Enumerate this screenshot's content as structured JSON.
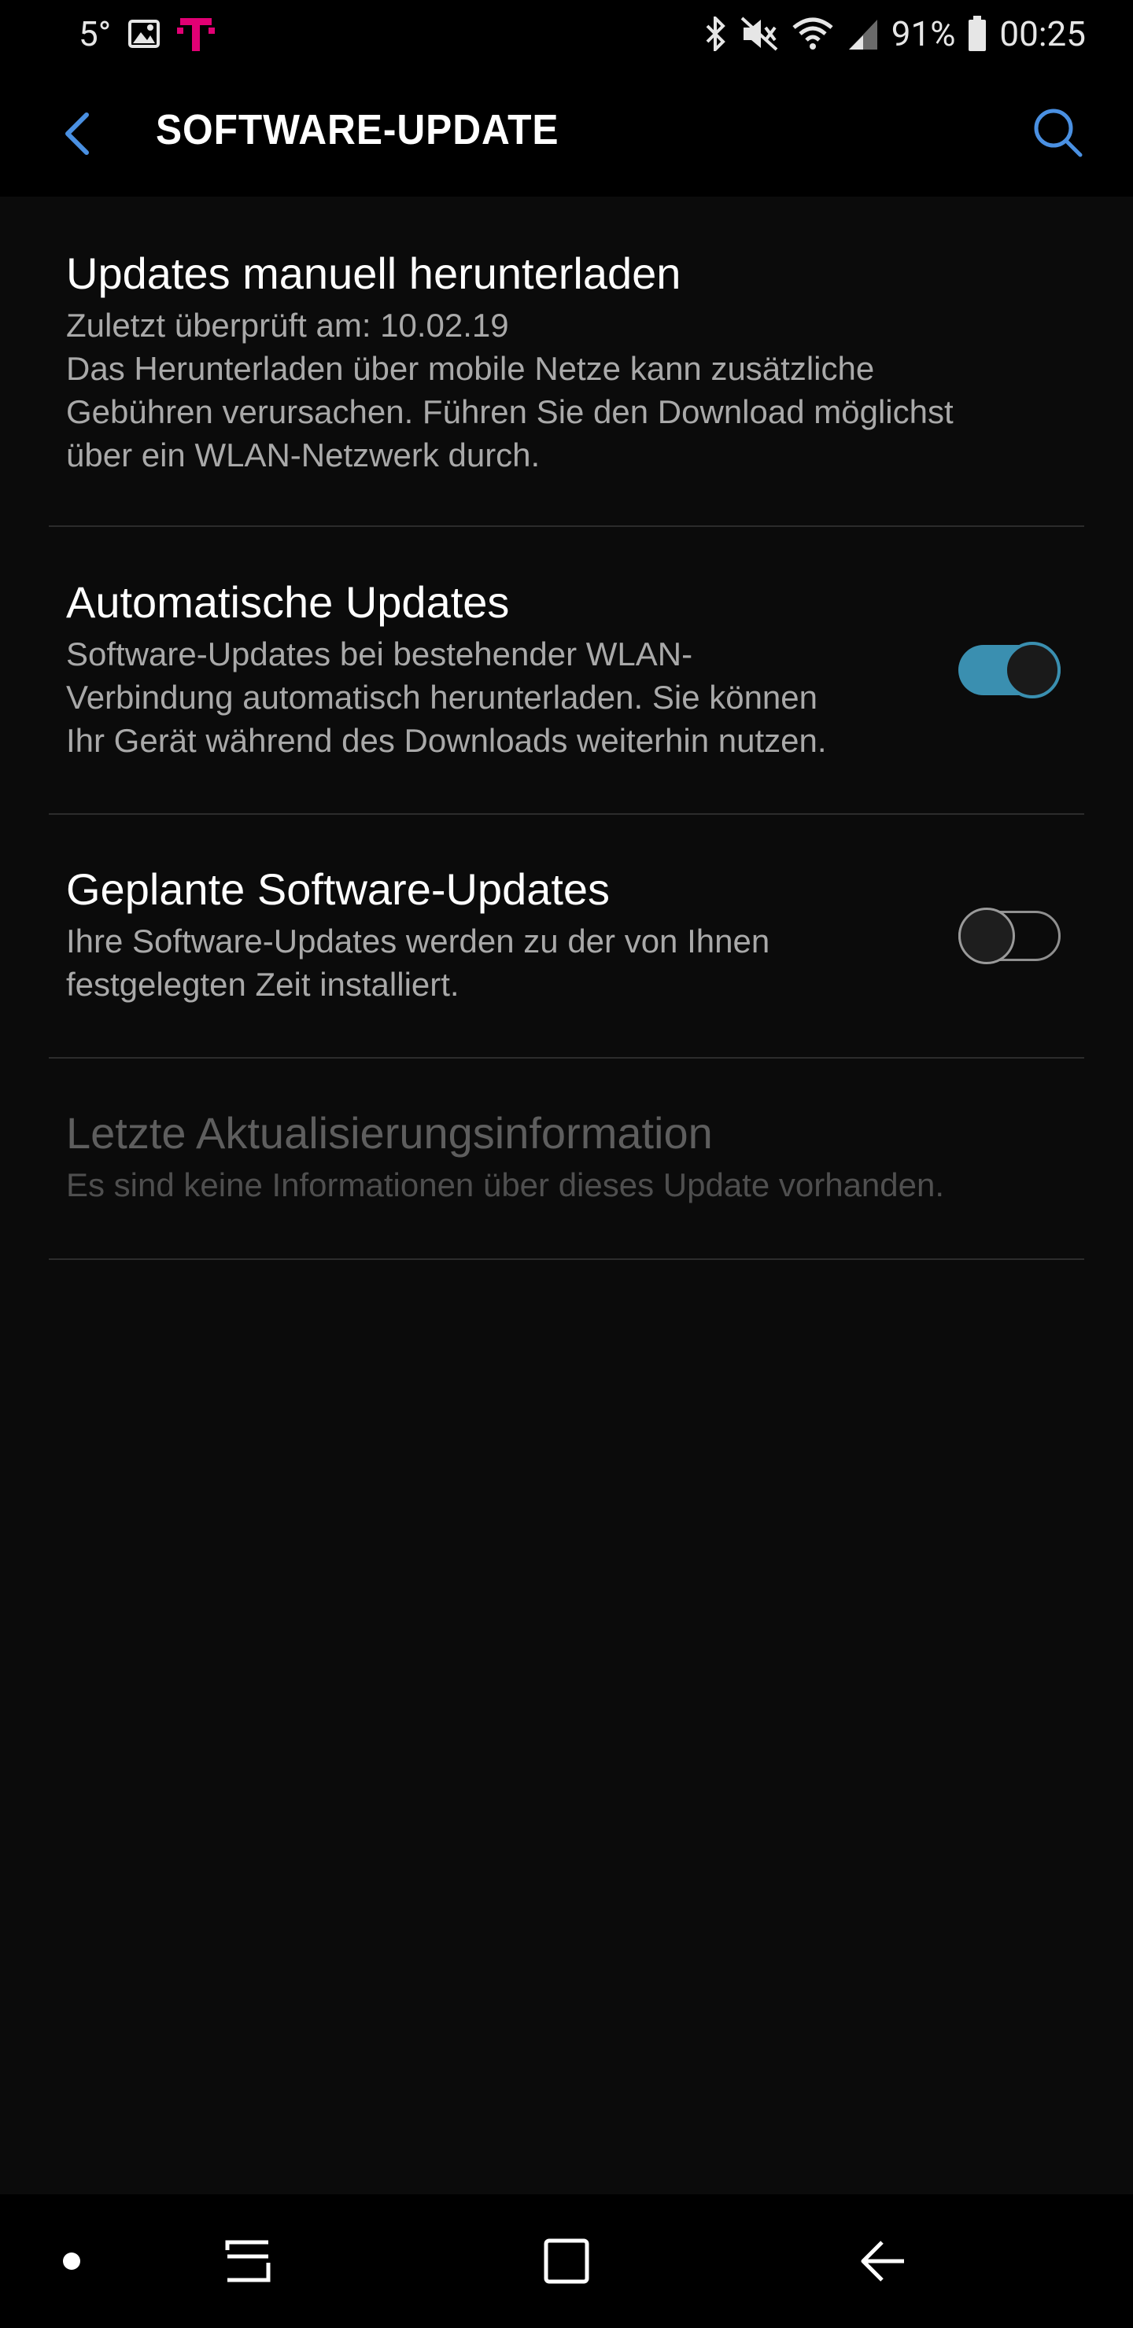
{
  "status_bar": {
    "temperature": "5°",
    "battery": "91%",
    "time": "00:25",
    "carrier_brand_color": "#e20074"
  },
  "header": {
    "title": "SOFTWARE-UPDATE",
    "accent_color": "#4a90e2"
  },
  "items": [
    {
      "title": "Updates manuell herunterladen",
      "subtitle_lines": [
        "Zuletzt überprüft am: 10.02.19",
        "Das Herunterladen über mobile Netze kann zusätzliche",
        "Gebühren verursachen. Führen Sie den Download möglichst",
        "über ein WLAN-Netzwerk durch."
      ]
    },
    {
      "title": "Automatische Updates",
      "subtitle_lines": [
        "Software-Updates bei bestehender WLAN-",
        "Verbindung automatisch herunterladen. Sie können",
        "Ihr Gerät während des Downloads weiterhin nutzen."
      ],
      "toggle_on": true
    },
    {
      "title": "Geplante Software-Updates",
      "subtitle_lines": [
        "Ihre Software-Updates werden zu der von Ihnen",
        "festgelegten Zeit installiert."
      ],
      "toggle_on": false
    },
    {
      "title": "Letzte Aktualisierungsinformation",
      "subtitle_lines": [
        "Es sind keine Informationen über dieses Update vorhanden."
      ],
      "disabled": true
    }
  ],
  "toggle_color": "#3a8fb0"
}
